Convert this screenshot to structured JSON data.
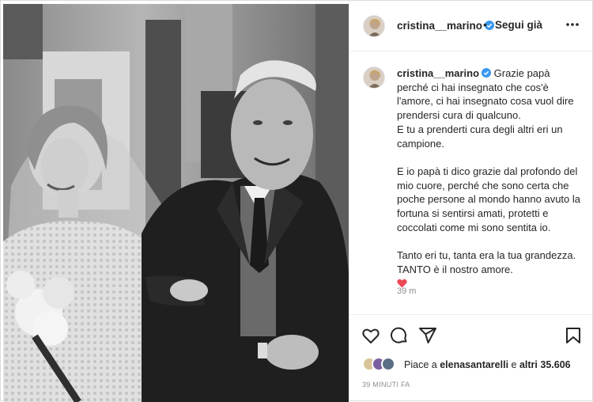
{
  "colors": {
    "accent_blue": "#0095f6",
    "verified_blue": "#3897f0",
    "heart_red": "#ed4956",
    "text_primary": "#262626",
    "text_secondary": "#8e8e8e"
  },
  "header": {
    "username": "cristina__marino",
    "separator": "•",
    "follow_label": "Segui già",
    "more_icon": "more-horizontal-icon"
  },
  "caption": {
    "username": "cristina__marino",
    "paragraphs": [
      "Grazie papà perché ci hai insegnato che cos'è l'amore, ci hai insegnato cosa vuol dire prendersi cura di qualcuno.",
      "E tu a prenderti cura degli altri eri un campione.",
      "E io papà ti dico grazie dal profondo del mio cuore, perché che sono certa che poche persone al mondo hanno avuto la fortuna si sentirsi amati, protetti e coccolati come mi sono sentita io.",
      "Tanto eri tu, tanta era la tua grandezza.",
      "TANTO è il nostro amore."
    ],
    "emoji": "heart-emoji",
    "time": "39 m"
  },
  "actions": {
    "like_icon": "heart-outline-icon",
    "comment_icon": "comment-icon",
    "share_icon": "share-icon",
    "save_icon": "bookmark-icon"
  },
  "likes": {
    "prefix": "Piace a",
    "user": "elenasantarelli",
    "conj": "e",
    "others": "altri 35.606"
  },
  "timestamp": "39 MINUTI FA"
}
